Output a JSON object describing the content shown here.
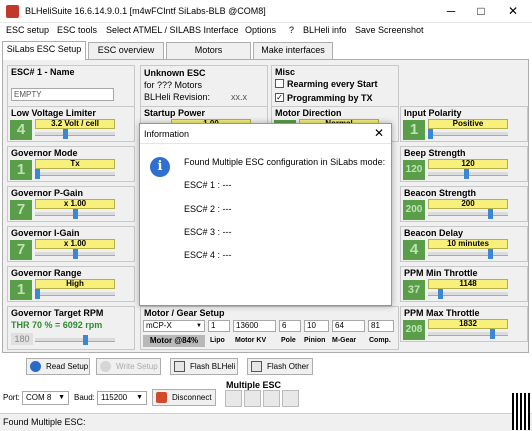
{
  "window": {
    "title": "BLHeliSuite 16.6.14.9.0.1  [m4wFCIntf SiLabs-BLB @COM8]",
    "buttons": [
      "─",
      "□",
      "✕"
    ]
  },
  "menu": [
    "ESC setup",
    "ESC tools",
    "Select ATMEL / SILABS Interface",
    "Options",
    "?",
    "BLHeli info",
    "Save Screenshot"
  ],
  "tabs": [
    "SiLabs ESC Setup",
    "ESC overview",
    "Motors",
    "Make interfaces"
  ],
  "esc_name": {
    "label": "ESC# 1 - Name",
    "value": "EMPTY"
  },
  "esc_info": {
    "line1": "Unknown ESC",
    "line2": "for  ???  Motors",
    "line3": "BLHeli Revision:",
    "revision": "xx.x"
  },
  "misc": {
    "label": "Misc",
    "options": [
      {
        "text": "Rearming every Start",
        "checked": false
      },
      {
        "text": "Programming by TX",
        "checked": true
      }
    ]
  },
  "low_voltage": {
    "label": "Low Voltage Limiter",
    "num": "4",
    "value": "3.2 Volt / cell"
  },
  "startup_power": {
    "label": "Startup Power",
    "value": "1.00"
  },
  "motor_direction": {
    "label": "Motor Direction",
    "value": "Normal"
  },
  "input_polarity": {
    "label": "Input Polarity",
    "num": "1",
    "value": "Positive"
  },
  "governor_mode": {
    "label": "Governor Mode",
    "num": "1",
    "value": "Tx"
  },
  "beep_strength": {
    "label": "Beep Strength",
    "num": "120",
    "value": "120"
  },
  "governor_p_gain": {
    "label": "Governor P-Gain",
    "num": "7",
    "value": "x 1.00"
  },
  "beacon_strength": {
    "label": "Beacon Strength",
    "num": "200",
    "value": "200"
  },
  "governor_i_gain": {
    "label": "Governor I-Gain",
    "num": "7",
    "value": "x 1.00"
  },
  "beacon_delay": {
    "label": "Beacon Delay",
    "num": "4",
    "value": "10 minutes"
  },
  "governor_range": {
    "label": "Governor Range",
    "num": "1",
    "value": "High"
  },
  "ppm_min": {
    "label": "PPM Min Throttle",
    "num": "37",
    "value": "1148"
  },
  "governor_target": {
    "label": "Governor Target RPM",
    "thr": "THR 70 % = 6092 rpm",
    "num": "180"
  },
  "ppm_max": {
    "label": "PPM Max Throttle",
    "num": "208",
    "value": "1832"
  },
  "motor_gear": {
    "label": "Motor / Gear Setup",
    "model": "mCP-X",
    "lipo": "1",
    "kv": "13600",
    "pole": "6",
    "pinion": "10",
    "mgear": "64",
    "comp": "81",
    "motor_pct": "Motor @84%",
    "headers": [
      "Lipo",
      "Motor KV",
      "Pole",
      "Pinion",
      "M-Gear",
      "Comp."
    ]
  },
  "dialog": {
    "title": "Information",
    "message": "Found Multiple ESC configuration in SiLabs mode:",
    "escs": [
      "ESC# 1 :  ---",
      "ESC# 2 :  ---",
      "ESC# 3 :  ---",
      "ESC# 4 :  ---"
    ]
  },
  "bottom": {
    "read": "Read Setup",
    "write": "Write Setup",
    "flash_blheli": "Flash BLHeli",
    "flash_other": "Flash Other"
  },
  "multiple_esc": "Multiple ESC",
  "port": {
    "label": "Port:",
    "value": "COM 8",
    "baud_label": "Baud:",
    "baud": "115200",
    "disconnect": "Disconnect"
  },
  "status": "Found Multiple ESC:",
  "colors": {
    "accent_green": "#5a9e4a",
    "value_yellow": "#f7f07a",
    "dialog_blue": "#2f6fd0"
  }
}
